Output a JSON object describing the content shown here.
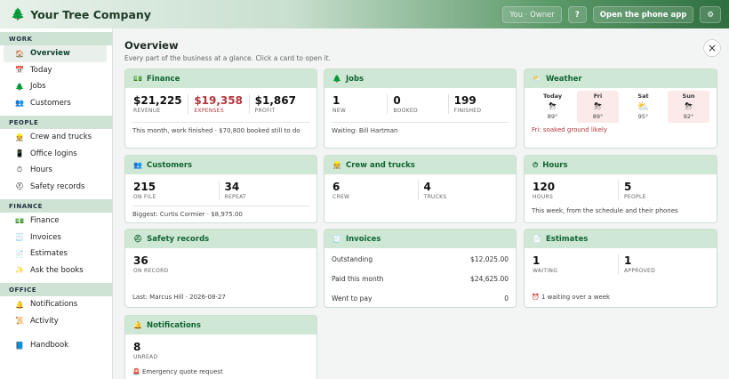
{
  "topbar": {
    "brand": "Your Tree Company",
    "user": "You · Owner",
    "help": "?",
    "phone_app": "Open the phone app",
    "settings": "⚙"
  },
  "sidebar": {
    "sections": [
      {
        "title": "WORK",
        "items": [
          {
            "label": "Overview",
            "icon": "home-icon",
            "glyph": "🏠",
            "active": true
          },
          {
            "label": "Today",
            "icon": "calendar-icon",
            "glyph": "📅"
          },
          {
            "label": "Jobs",
            "icon": "tree-icon",
            "glyph": "🌲"
          },
          {
            "label": "Customers",
            "icon": "people-icon",
            "glyph": "👥"
          }
        ]
      },
      {
        "title": "PEOPLE",
        "items": [
          {
            "label": "Crew and trucks",
            "icon": "worker-icon",
            "glyph": "👷"
          },
          {
            "label": "Office logins",
            "icon": "phone-icon",
            "glyph": "📱"
          },
          {
            "label": "Hours",
            "icon": "clock-icon",
            "glyph": "⏱"
          },
          {
            "label": "Safety records",
            "icon": "first-aid-icon",
            "glyph": "⛑"
          }
        ]
      },
      {
        "title": "FINANCE",
        "items": [
          {
            "label": "Finance",
            "icon": "money-icon",
            "glyph": "💵"
          },
          {
            "label": "Invoices",
            "icon": "invoice-icon",
            "glyph": "🧾"
          },
          {
            "label": "Estimates",
            "icon": "document-icon",
            "glyph": "📄"
          },
          {
            "label": "Ask the books",
            "icon": "sparkle-icon",
            "glyph": "✨"
          }
        ]
      },
      {
        "title": "OFFICE",
        "items": [
          {
            "label": "Notifications",
            "icon": "bell-icon",
            "glyph": "🔔"
          },
          {
            "label": "Activity",
            "icon": "scroll-icon",
            "glyph": "📜"
          }
        ]
      }
    ],
    "handbook": {
      "label": "Handbook",
      "icon": "book-icon",
      "glyph": "📘"
    }
  },
  "main": {
    "title": "Overview",
    "subtitle": "Every part of the business at a glance. Click a card to open it.",
    "close": "×"
  },
  "cards": {
    "finance": {
      "title": "Finance",
      "glyph": "💵",
      "stats": [
        {
          "value": "$21,225",
          "label": "REVENUE"
        },
        {
          "value": "$19,358",
          "label": "EXPENSES"
        },
        {
          "value": "$1,867",
          "label": "PROFIT"
        }
      ],
      "footer": "This month, work finished · $70,800 booked still to do"
    },
    "jobs": {
      "title": "Jobs",
      "glyph": "🌲",
      "stats": [
        {
          "value": "1",
          "label": "NEW"
        },
        {
          "value": "0",
          "label": "BOOKED"
        },
        {
          "value": "199",
          "label": "FINISHED"
        }
      ],
      "footer": "Waiting: Bill Hartman"
    },
    "weather": {
      "title": "Weather",
      "glyph": "⛅",
      "days": [
        {
          "name": "Today",
          "glyph": "⛈",
          "icon": "storm-icon",
          "temp": "89°",
          "bad": false
        },
        {
          "name": "Fri",
          "glyph": "⛈",
          "icon": "storm-icon",
          "temp": "89°",
          "bad": true
        },
        {
          "name": "Sat",
          "glyph": "⛅",
          "icon": "partly-cloudy-icon",
          "temp": "95°",
          "bad": false
        },
        {
          "name": "Sun",
          "glyph": "⛈",
          "icon": "storm-icon",
          "temp": "92°",
          "bad": true
        }
      ],
      "footer": "Fri: soaked ground likely"
    },
    "customers": {
      "title": "Customers",
      "glyph": "👥",
      "stats": [
        {
          "value": "215",
          "label": "ON FILE"
        },
        {
          "value": "34",
          "label": "REPEAT"
        }
      ],
      "footer": "Biggest: Curtis Cormier · $8,975.00"
    },
    "crew": {
      "title": "Crew and trucks",
      "glyph": "👷",
      "stats": [
        {
          "value": "6",
          "label": "CREW"
        },
        {
          "value": "4",
          "label": "TRUCKS"
        }
      ]
    },
    "hours": {
      "title": "Hours",
      "glyph": "⏱",
      "stats": [
        {
          "value": "120",
          "label": "HOURS"
        },
        {
          "value": "5",
          "label": "PEOPLE"
        }
      ],
      "footer": "This week, from the schedule and their phones"
    },
    "safety": {
      "title": "Safety records",
      "glyph": "⛑",
      "stats": [
        {
          "value": "36",
          "label": "ON RECORD"
        }
      ],
      "footer": "Last: Marcus Hill · 2026-08-27"
    },
    "invoices": {
      "title": "Invoices",
      "glyph": "🧾",
      "rows": [
        {
          "label": "Outstanding",
          "value": "$12,025.00"
        },
        {
          "label": "Paid this month",
          "value": "$24,625.00"
        },
        {
          "label": "Went to pay",
          "value": "0"
        }
      ]
    },
    "estimates": {
      "title": "Estimates",
      "glyph": "📄",
      "stats": [
        {
          "value": "1",
          "label": "WAITING"
        },
        {
          "value": "1",
          "label": "APPROVED"
        }
      ],
      "footer": "⏰ 1 waiting over a week"
    },
    "notifications": {
      "title": "Notifications",
      "glyph": "🔔",
      "stats": [
        {
          "value": "8",
          "label": "UNREAD"
        }
      ],
      "footer": "🚨 Emergency quote request"
    }
  },
  "colors": {
    "accent": "#2f6f3f",
    "header_bg": "#cfe7d5",
    "alert": "#b3363b"
  }
}
